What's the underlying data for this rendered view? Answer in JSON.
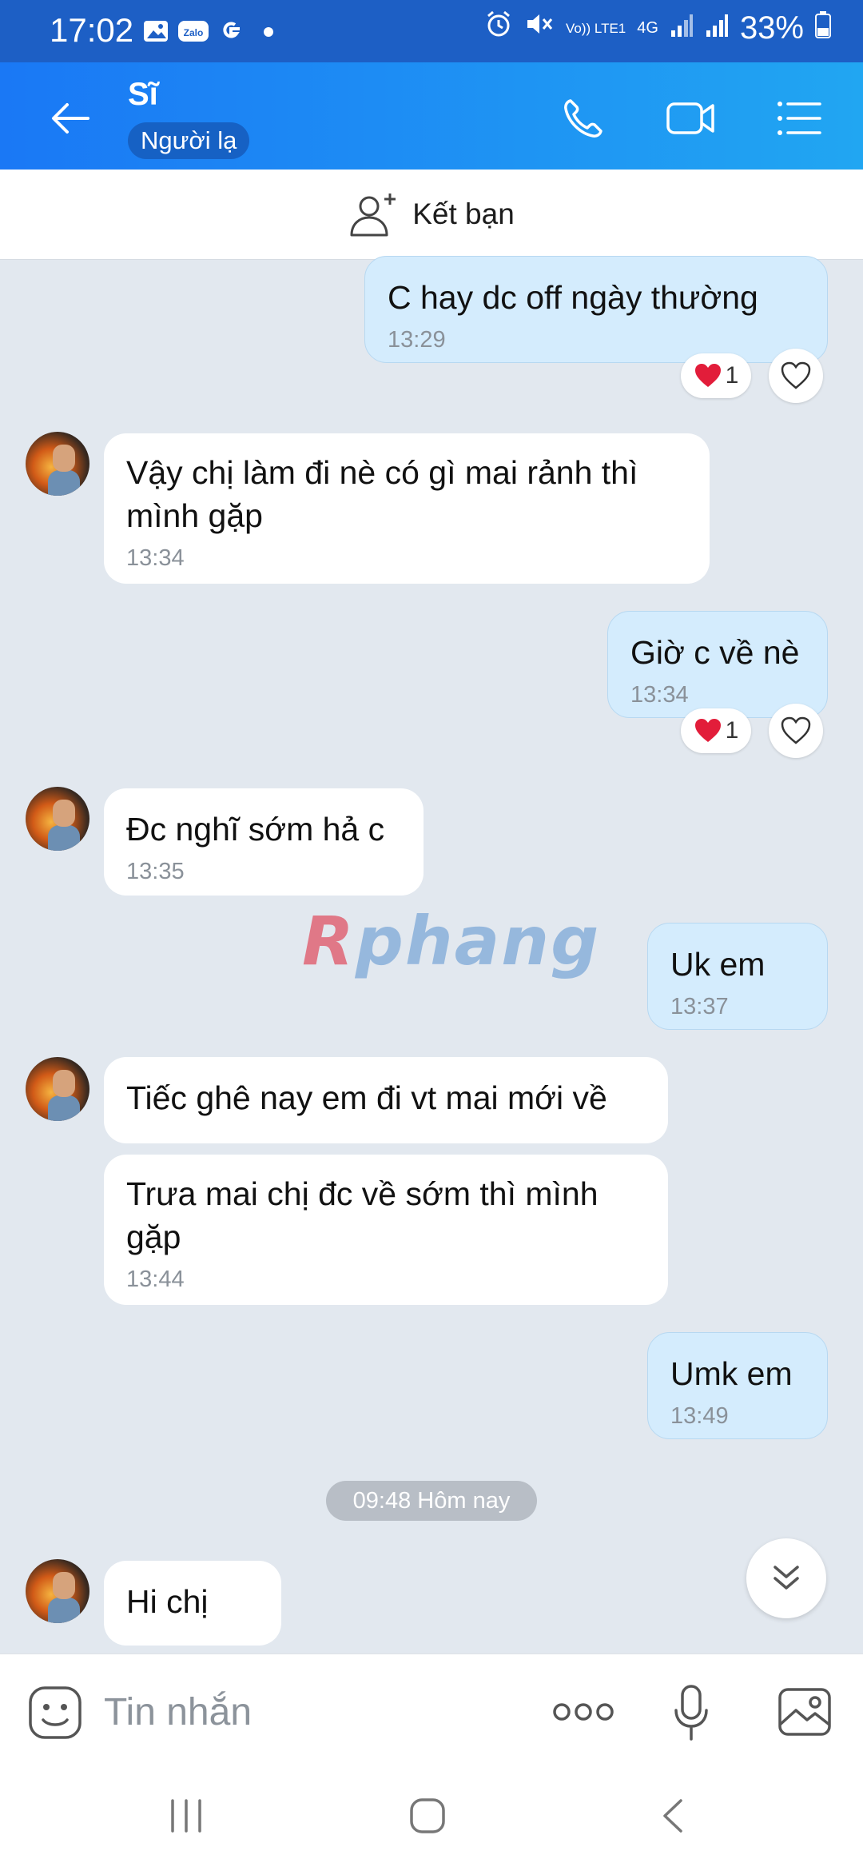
{
  "status_bar": {
    "time": "17:02",
    "network_label": "Vo)) LTE1",
    "network_type": "4G",
    "battery": "33%"
  },
  "header": {
    "contact_name": "Sĩ",
    "badge": "Người lạ",
    "icons": [
      "back-arrow-icon",
      "phone-icon",
      "video-call-icon",
      "menu-list-icon"
    ]
  },
  "friend_bar": {
    "label": "Kết bạn"
  },
  "messages": [
    {
      "direction": "out",
      "text": "C hay dc off  ngày  thường",
      "time": "13:29",
      "reaction": "1"
    },
    {
      "direction": "in",
      "text": "Vậy chị làm đi nè có gì mai rảnh thì mình gặp",
      "time": "13:34"
    },
    {
      "direction": "out",
      "text": "Giờ c về nè",
      "time": "13:34",
      "reaction": "1"
    },
    {
      "direction": "in",
      "text": "Đc nghĩ sớm hả c",
      "time": "13:35"
    },
    {
      "direction": "out",
      "text": "Uk em",
      "time": "13:37"
    },
    {
      "direction": "in",
      "text": "Tiếc ghê nay em đi vt mai mới về",
      "time": ""
    },
    {
      "direction": "in",
      "text": "Trưa mai chị đc về sớm thì mình gặp",
      "time": "13:44"
    },
    {
      "direction": "out",
      "text": "Umk em",
      "time": "13:49"
    },
    {
      "direction": "in",
      "text": "Hi chị",
      "time": ""
    }
  ],
  "date_separator": "09:48 Hôm nay",
  "watermark": {
    "first": "R",
    "rest": "phang"
  },
  "input": {
    "placeholder": "Tin nhắn"
  },
  "colors": {
    "header_start": "#1a78f5",
    "header_end": "#21a6f2",
    "outgoing_bubble": "#d4ecfd",
    "background": "#e2e8ef"
  }
}
